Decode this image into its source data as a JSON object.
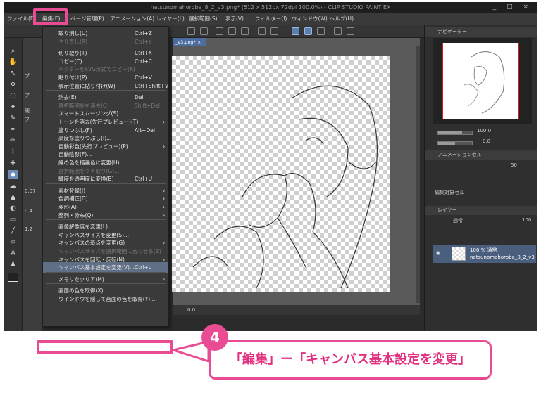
{
  "titlebar": {
    "title": "natsunomahoroba_8_2_v3.png* (512 x 512px 72dpi 100.0%)  - CLIP STUDIO PAINT EX",
    "controls": "_ □ ×"
  },
  "menubar": {
    "items": [
      "ファイル(F)",
      "編集(E)",
      "ページ管理(P)",
      "アニメーション(A)",
      "レイヤー(L)",
      "選択範囲(S)",
      "表示(V)",
      "フィルター(I)",
      "ウィンドウ(W)",
      "ヘルプ(H)"
    ]
  },
  "document": {
    "tab_label": "_v3.png* ×",
    "status_zoom": "0.0"
  },
  "tool_options": {
    "values": [
      "0.07",
      "0.4",
      "1.2"
    ]
  },
  "navigator": {
    "title": "ナビゲーター",
    "zoom": "100.0",
    "angle": "0.0"
  },
  "animation_cel": {
    "title": "アニメーションセル",
    "value": "50",
    "footer": "編集対象セル"
  },
  "layers_panel": {
    "title": "レイヤー",
    "blend_mode": "通常",
    "opacity": "100",
    "layer_opacity_label": "100 % 通常",
    "layer_name": "natsunomahoroba_8_2_v3"
  },
  "edit_menu": {
    "items": [
      {
        "label": "取り消し(U)",
        "shortcut": "Ctrl+Z",
        "disabled": false,
        "submenu": false
      },
      {
        "label": "やり直し(R)",
        "shortcut": "Ctrl+Y",
        "disabled": true,
        "submenu": false
      },
      {
        "sep": true
      },
      {
        "label": "切り取り(T)",
        "shortcut": "Ctrl+X",
        "disabled": false,
        "submenu": false
      },
      {
        "label": "コピー(C)",
        "shortcut": "Ctrl+C",
        "disabled": false,
        "submenu": false
      },
      {
        "label": "ベクターをSVG形式でコピー(K)",
        "shortcut": "",
        "disabled": true,
        "submenu": false
      },
      {
        "label": "貼り付け(P)",
        "shortcut": "Ctrl+V",
        "disabled": false,
        "submenu": false
      },
      {
        "label": "表示位置に貼り付け(W)",
        "shortcut": "Ctrl+Shift+V",
        "disabled": false,
        "submenu": false
      },
      {
        "sep": true
      },
      {
        "label": "消去(E)",
        "shortcut": "Del",
        "disabled": false,
        "submenu": false
      },
      {
        "label": "選択範囲外を消去(O)",
        "shortcut": "Shift+Del",
        "disabled": true,
        "submenu": false
      },
      {
        "label": "スマートスムージング(S)...",
        "shortcut": "",
        "disabled": false,
        "submenu": false
      },
      {
        "label": "トーンを消去(先行プレビュー)(T)",
        "shortcut": "",
        "disabled": false,
        "submenu": true
      },
      {
        "label": "塗りつぶし(F)",
        "shortcut": "Alt+Del",
        "disabled": false,
        "submenu": false
      },
      {
        "label": "高度な塗りつぶし(I)...",
        "shortcut": "",
        "disabled": false,
        "submenu": false
      },
      {
        "label": "自動彩色(先行プレビュー)(P)",
        "shortcut": "",
        "disabled": false,
        "submenu": true
      },
      {
        "label": "自動陰影(F)...",
        "shortcut": "",
        "disabled": false,
        "submenu": false
      },
      {
        "label": "線の色を描画色に変更(H)",
        "shortcut": "",
        "disabled": false,
        "submenu": false
      },
      {
        "label": "選択範囲をフチ取り(G)...",
        "shortcut": "",
        "disabled": true,
        "submenu": false
      },
      {
        "label": "輝度を透明度に変換(B)",
        "shortcut": "Ctrl+U",
        "disabled": false,
        "submenu": false
      },
      {
        "sep": true
      },
      {
        "label": "素材登録(J)",
        "shortcut": "",
        "disabled": false,
        "submenu": true
      },
      {
        "label": "色調補正(D)",
        "shortcut": "",
        "disabled": false,
        "submenu": true
      },
      {
        "label": "変形(A)",
        "shortcut": "",
        "disabled": false,
        "submenu": true
      },
      {
        "label": "整列・分布(Q)",
        "shortcut": "",
        "disabled": false,
        "submenu": true
      },
      {
        "sep": true
      },
      {
        "label": "画像解像度を変更(L)...",
        "shortcut": "",
        "disabled": false,
        "submenu": false
      },
      {
        "label": "キャンバスサイズを変更(S)...",
        "shortcut": "",
        "disabled": false,
        "submenu": false
      },
      {
        "label": "キャンバスの基点を変更(G)",
        "shortcut": "",
        "disabled": false,
        "submenu": true
      },
      {
        "label": "キャンバスサイズを選択範囲に合わせる(Z)",
        "shortcut": "",
        "disabled": true,
        "submenu": false
      },
      {
        "label": "キャンバスを回転・反転(N)",
        "shortcut": "",
        "disabled": false,
        "submenu": true
      },
      {
        "label": "キャンバス基本設定を変更(V)...",
        "shortcut": "Ctrl+L",
        "disabled": false,
        "submenu": false,
        "active": true
      },
      {
        "sep": true
      },
      {
        "label": "メモリをクリア(M)",
        "shortcut": "",
        "disabled": false,
        "submenu": true
      },
      {
        "sep": true
      },
      {
        "label": "画面の色を取得(X)...",
        "shortcut": "",
        "disabled": false,
        "submenu": false
      },
      {
        "label": "ウインドウを隠して画面の色を取得(Y)...",
        "shortcut": "",
        "disabled": false,
        "submenu": false
      }
    ]
  },
  "callout": {
    "step": "4",
    "text": "「編集」ー「キャンバス基本設定を変更」",
    "accent": "#e94c93"
  }
}
